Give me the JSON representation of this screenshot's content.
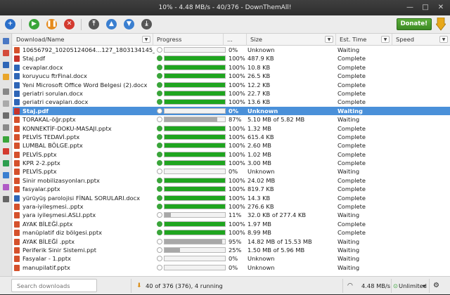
{
  "window": {
    "title": "10% - 4.48 MB/s - 40/376 - DownThemAll!"
  },
  "toolbar": {
    "donate_label": "Donate!"
  },
  "columns": [
    "Download/Name",
    "Progress",
    "...",
    "Size",
    "Est. Time",
    "Speed"
  ],
  "rows": [
    {
      "name": "10656792_10205124064...127_1803134145_n.ppt",
      "icon": "ppt",
      "status": "waiting",
      "progress": 0.0,
      "pct": "0%",
      "size": "Unknown",
      "est": "Waiting"
    },
    {
      "name": "Staj.pdf",
      "icon": "pdf",
      "status": "ok",
      "progress": 1.0,
      "pct": "100%",
      "size": "487.9 KB",
      "est": "Complete"
    },
    {
      "name": "cevaplar.docx",
      "icon": "doc",
      "status": "ok",
      "progress": 1.0,
      "pct": "100%",
      "size": "10.8 KB",
      "est": "Complete"
    },
    {
      "name": "koruyucu ftrFinal.docx",
      "icon": "doc",
      "status": "ok",
      "progress": 1.0,
      "pct": "100%",
      "size": "26.5 KB",
      "est": "Complete"
    },
    {
      "name": "Yeni Microsoft Office Word Belgesi (2).docx",
      "icon": "doc",
      "status": "ok",
      "progress": 1.0,
      "pct": "100%",
      "size": "12.2 KB",
      "est": "Complete"
    },
    {
      "name": "geriatri sorulan.docx",
      "icon": "doc",
      "status": "ok",
      "progress": 1.0,
      "pct": "100%",
      "size": "22.7 KB",
      "est": "Complete"
    },
    {
      "name": "geriatri cevapları.docx",
      "icon": "doc",
      "status": "ok",
      "progress": 1.0,
      "pct": "100%",
      "size": "13.6 KB",
      "est": "Complete"
    },
    {
      "name": "Staj.pdf",
      "icon": "pdf",
      "status": "waiting",
      "progress": 0.0,
      "pct": "0%",
      "size": "Unknown",
      "est": "Waiting",
      "selected": true
    },
    {
      "name": "TORAKAL-öğr.pptx",
      "icon": "ppt",
      "status": "waiting",
      "progress": 0.87,
      "pct": "87%",
      "size": "5.10 MB of 5.82 MB",
      "est": "Waiting"
    },
    {
      "name": "KONNEKTİF-DOKU-MASAJI.pptx",
      "icon": "ppt",
      "status": "ok",
      "progress": 1.0,
      "pct": "100%",
      "size": "1.32 MB",
      "est": "Complete"
    },
    {
      "name": "PELVİS TEDAVİ.pptx",
      "icon": "ppt",
      "status": "ok",
      "progress": 1.0,
      "pct": "100%",
      "size": "615.4 KB",
      "est": "Complete"
    },
    {
      "name": "LUMBAL BÖLGE.pptx",
      "icon": "ppt",
      "status": "ok",
      "progress": 1.0,
      "pct": "100%",
      "size": "2.60 MB",
      "est": "Complete"
    },
    {
      "name": "PELVİS.pptx",
      "icon": "ppt",
      "status": "ok",
      "progress": 1.0,
      "pct": "100%",
      "size": "1.02 MB",
      "est": "Complete"
    },
    {
      "name": "KPR 2-2.pptx",
      "icon": "ppt",
      "status": "ok",
      "progress": 1.0,
      "pct": "100%",
      "size": "3.00 MB",
      "est": "Complete"
    },
    {
      "name": "PELVİS.pptx",
      "icon": "ppt",
      "status": "waiting",
      "progress": 0.0,
      "pct": "0%",
      "size": "Unknown",
      "est": "Waiting"
    },
    {
      "name": "Sinir mobilizasyonları.pptx",
      "icon": "ppt",
      "status": "ok",
      "progress": 1.0,
      "pct": "100%",
      "size": "24.02 MB",
      "est": "Complete"
    },
    {
      "name": "fasyalar.pptx",
      "icon": "ppt",
      "status": "ok",
      "progress": 1.0,
      "pct": "100%",
      "size": "819.7 KB",
      "est": "Complete"
    },
    {
      "name": "yürüyüş parolojisi FİNAL SORULARI.docx",
      "icon": "doc",
      "status": "ok",
      "progress": 1.0,
      "pct": "100%",
      "size": "14.3 KB",
      "est": "Complete"
    },
    {
      "name": "yara-iyileşmesi..pptx",
      "icon": "ppt",
      "status": "ok",
      "progress": 1.0,
      "pct": "100%",
      "size": "276.6 KB",
      "est": "Complete"
    },
    {
      "name": "yara iyileşmesi.ASLI.pptx",
      "icon": "ppt",
      "status": "waiting",
      "progress": 0.11,
      "pct": "11%",
      "size": "32.0 KB of 277.4 KB",
      "est": "Waiting"
    },
    {
      "name": "AYAK BİLEĞİ.pptx",
      "icon": "ppt",
      "status": "ok",
      "progress": 1.0,
      "pct": "100%",
      "size": "1.97 MB",
      "est": "Complete"
    },
    {
      "name": "manüplatif diz bölgesi.pptx",
      "icon": "ppt",
      "status": "ok",
      "progress": 1.0,
      "pct": "100%",
      "size": "8.99 MB",
      "est": "Complete"
    },
    {
      "name": "AYAK BİLEĞİ .pptx",
      "icon": "ppt",
      "status": "waiting",
      "progress": 0.95,
      "pct": "95%",
      "size": "14.82 MB of 15.53 MB",
      "est": "Waiting"
    },
    {
      "name": "Periferik Sinir Sistemi.ppt",
      "icon": "ppt",
      "status": "waiting",
      "progress": 0.25,
      "pct": "25%",
      "size": "1.50 MB of 5.96 MB",
      "est": "Waiting"
    },
    {
      "name": "Fasyalar - 1.pptx",
      "icon": "ppt",
      "status": "waiting",
      "progress": 0.0,
      "pct": "0%",
      "size": "Unknown",
      "est": "Waiting"
    },
    {
      "name": "manupilatif.pptx",
      "icon": "ppt",
      "status": "waiting",
      "progress": 0.0,
      "pct": "0%",
      "size": "Unknown",
      "est": "Waiting"
    }
  ],
  "statusbar": {
    "search_placeholder": "Search downloads",
    "summary": "40 of 376 (376), 4 running",
    "speed": "4.48 MB/s",
    "limit": "Unlimited"
  },
  "colors": {
    "selection": "#4a90d9",
    "progress_done": "#1fa51f",
    "progress_partial": "#a8a8a8",
    "donate": "#3c8a24"
  }
}
